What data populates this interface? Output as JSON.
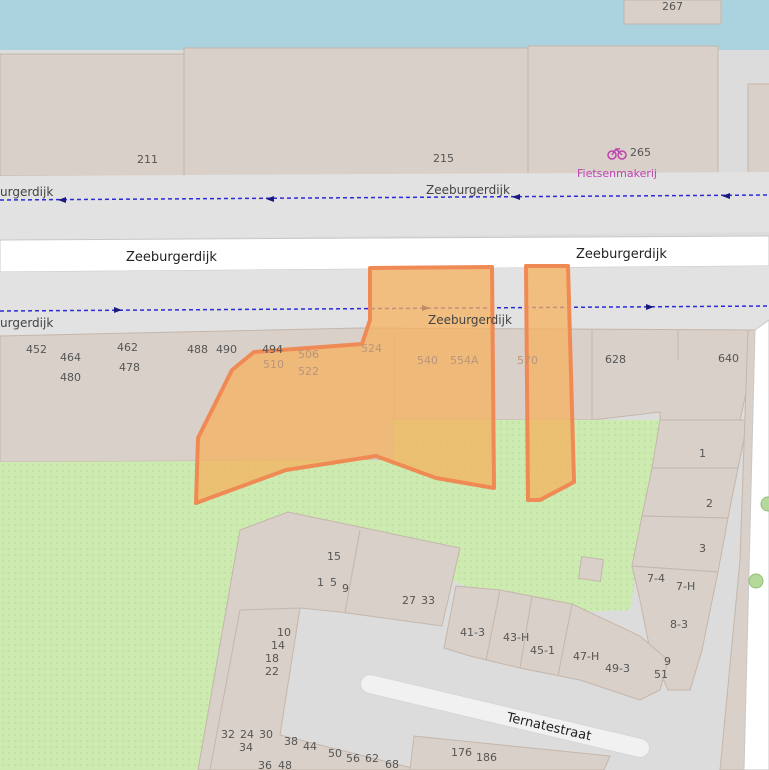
{
  "map": {
    "colors": {
      "water": "#aad3df",
      "building": "#d9d0c9",
      "building_stroke": "#c4b6ab",
      "road": "#ffffff",
      "road_casing": "#c8c8c8",
      "footway": "#dddddd",
      "grass": "#cdebb0",
      "highlight_fill": "#f5b15f",
      "highlight_stroke": "#f08a54",
      "cycle_route": "#2b2bd8",
      "poi": "#c040b0"
    },
    "street_labels": {
      "zeeburgerdijk_main_left": "Zeeburgerdijk",
      "zeeburgerdijk_main_right": "Zeeburgerdijk",
      "zeeburgerdijk_upper_left": "urgerdijk",
      "zeeburgerdijk_upper_mid": "Zeeburgerdijk",
      "zeeburgerdijk_lower_left": "urgerdijk",
      "zeeburgerdijk_lower_mid": "Zeeburgerdijk",
      "ternatestraat": "Ternatestraat"
    },
    "poi": {
      "icon": "bicycle-icon",
      "name": "Fietsenmakerij",
      "number": "265"
    },
    "house_numbers": {
      "n267": "267",
      "n211": "211",
      "n215": "215",
      "n452": "452",
      "n464": "464",
      "n480": "480",
      "n462": "462",
      "n478": "478",
      "n488": "488",
      "n490": "490",
      "n494": "494",
      "n506": "506",
      "n510": "510",
      "n522": "522",
      "n524": "524",
      "n540": "540",
      "n554a": "554A",
      "n570": "570",
      "n628": "628",
      "n640": "640",
      "n1": "1",
      "n2": "2",
      "n3": "3",
      "n7_4": "7-4",
      "n7_h": "7-H",
      "n8_3": "8-3",
      "n9": "9",
      "n51": "51",
      "n15": "15",
      "n1b": "1",
      "n5": "5",
      "n9b": "9",
      "n27": "27",
      "n33": "33",
      "n41_3": "41-3",
      "n43_h": "43-H",
      "n45_1": "45-1",
      "n47_h": "47-H",
      "n49_3": "49-3",
      "n10": "10",
      "n14": "14",
      "n18": "18",
      "n22": "22",
      "n32": "32",
      "n24": "24",
      "n30": "30",
      "n34": "34",
      "n38": "38",
      "n44": "44",
      "n36": "36",
      "n48": "48",
      "n50": "50",
      "n56": "56",
      "n62": "62",
      "n68": "68",
      "n176": "176",
      "n186": "186"
    }
  }
}
